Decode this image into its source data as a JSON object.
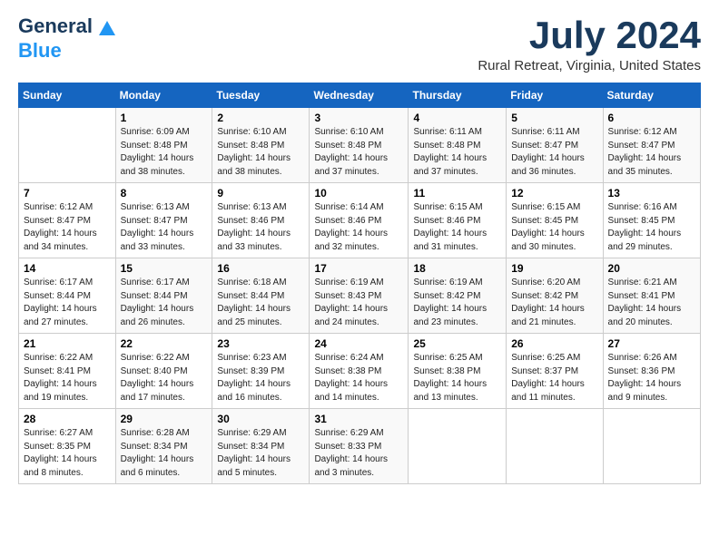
{
  "logo": {
    "general": "General",
    "blue": "Blue"
  },
  "title": "July 2024",
  "location": "Rural Retreat, Virginia, United States",
  "weekdays": [
    "Sunday",
    "Monday",
    "Tuesday",
    "Wednesday",
    "Thursday",
    "Friday",
    "Saturday"
  ],
  "weeks": [
    [
      {
        "day": "",
        "sunrise": "",
        "sunset": "",
        "daylight": ""
      },
      {
        "day": "1",
        "sunrise": "Sunrise: 6:09 AM",
        "sunset": "Sunset: 8:48 PM",
        "daylight": "Daylight: 14 hours and 38 minutes."
      },
      {
        "day": "2",
        "sunrise": "Sunrise: 6:10 AM",
        "sunset": "Sunset: 8:48 PM",
        "daylight": "Daylight: 14 hours and 38 minutes."
      },
      {
        "day": "3",
        "sunrise": "Sunrise: 6:10 AM",
        "sunset": "Sunset: 8:48 PM",
        "daylight": "Daylight: 14 hours and 37 minutes."
      },
      {
        "day": "4",
        "sunrise": "Sunrise: 6:11 AM",
        "sunset": "Sunset: 8:48 PM",
        "daylight": "Daylight: 14 hours and 37 minutes."
      },
      {
        "day": "5",
        "sunrise": "Sunrise: 6:11 AM",
        "sunset": "Sunset: 8:47 PM",
        "daylight": "Daylight: 14 hours and 36 minutes."
      },
      {
        "day": "6",
        "sunrise": "Sunrise: 6:12 AM",
        "sunset": "Sunset: 8:47 PM",
        "daylight": "Daylight: 14 hours and 35 minutes."
      }
    ],
    [
      {
        "day": "7",
        "sunrise": "Sunrise: 6:12 AM",
        "sunset": "Sunset: 8:47 PM",
        "daylight": "Daylight: 14 hours and 34 minutes."
      },
      {
        "day": "8",
        "sunrise": "Sunrise: 6:13 AM",
        "sunset": "Sunset: 8:47 PM",
        "daylight": "Daylight: 14 hours and 33 minutes."
      },
      {
        "day": "9",
        "sunrise": "Sunrise: 6:13 AM",
        "sunset": "Sunset: 8:46 PM",
        "daylight": "Daylight: 14 hours and 33 minutes."
      },
      {
        "day": "10",
        "sunrise": "Sunrise: 6:14 AM",
        "sunset": "Sunset: 8:46 PM",
        "daylight": "Daylight: 14 hours and 32 minutes."
      },
      {
        "day": "11",
        "sunrise": "Sunrise: 6:15 AM",
        "sunset": "Sunset: 8:46 PM",
        "daylight": "Daylight: 14 hours and 31 minutes."
      },
      {
        "day": "12",
        "sunrise": "Sunrise: 6:15 AM",
        "sunset": "Sunset: 8:45 PM",
        "daylight": "Daylight: 14 hours and 30 minutes."
      },
      {
        "day": "13",
        "sunrise": "Sunrise: 6:16 AM",
        "sunset": "Sunset: 8:45 PM",
        "daylight": "Daylight: 14 hours and 29 minutes."
      }
    ],
    [
      {
        "day": "14",
        "sunrise": "Sunrise: 6:17 AM",
        "sunset": "Sunset: 8:44 PM",
        "daylight": "Daylight: 14 hours and 27 minutes."
      },
      {
        "day": "15",
        "sunrise": "Sunrise: 6:17 AM",
        "sunset": "Sunset: 8:44 PM",
        "daylight": "Daylight: 14 hours and 26 minutes."
      },
      {
        "day": "16",
        "sunrise": "Sunrise: 6:18 AM",
        "sunset": "Sunset: 8:44 PM",
        "daylight": "Daylight: 14 hours and 25 minutes."
      },
      {
        "day": "17",
        "sunrise": "Sunrise: 6:19 AM",
        "sunset": "Sunset: 8:43 PM",
        "daylight": "Daylight: 14 hours and 24 minutes."
      },
      {
        "day": "18",
        "sunrise": "Sunrise: 6:19 AM",
        "sunset": "Sunset: 8:42 PM",
        "daylight": "Daylight: 14 hours and 23 minutes."
      },
      {
        "day": "19",
        "sunrise": "Sunrise: 6:20 AM",
        "sunset": "Sunset: 8:42 PM",
        "daylight": "Daylight: 14 hours and 21 minutes."
      },
      {
        "day": "20",
        "sunrise": "Sunrise: 6:21 AM",
        "sunset": "Sunset: 8:41 PM",
        "daylight": "Daylight: 14 hours and 20 minutes."
      }
    ],
    [
      {
        "day": "21",
        "sunrise": "Sunrise: 6:22 AM",
        "sunset": "Sunset: 8:41 PM",
        "daylight": "Daylight: 14 hours and 19 minutes."
      },
      {
        "day": "22",
        "sunrise": "Sunrise: 6:22 AM",
        "sunset": "Sunset: 8:40 PM",
        "daylight": "Daylight: 14 hours and 17 minutes."
      },
      {
        "day": "23",
        "sunrise": "Sunrise: 6:23 AM",
        "sunset": "Sunset: 8:39 PM",
        "daylight": "Daylight: 14 hours and 16 minutes."
      },
      {
        "day": "24",
        "sunrise": "Sunrise: 6:24 AM",
        "sunset": "Sunset: 8:38 PM",
        "daylight": "Daylight: 14 hours and 14 minutes."
      },
      {
        "day": "25",
        "sunrise": "Sunrise: 6:25 AM",
        "sunset": "Sunset: 8:38 PM",
        "daylight": "Daylight: 14 hours and 13 minutes."
      },
      {
        "day": "26",
        "sunrise": "Sunrise: 6:25 AM",
        "sunset": "Sunset: 8:37 PM",
        "daylight": "Daylight: 14 hours and 11 minutes."
      },
      {
        "day": "27",
        "sunrise": "Sunrise: 6:26 AM",
        "sunset": "Sunset: 8:36 PM",
        "daylight": "Daylight: 14 hours and 9 minutes."
      }
    ],
    [
      {
        "day": "28",
        "sunrise": "Sunrise: 6:27 AM",
        "sunset": "Sunset: 8:35 PM",
        "daylight": "Daylight: 14 hours and 8 minutes."
      },
      {
        "day": "29",
        "sunrise": "Sunrise: 6:28 AM",
        "sunset": "Sunset: 8:34 PM",
        "daylight": "Daylight: 14 hours and 6 minutes."
      },
      {
        "day": "30",
        "sunrise": "Sunrise: 6:29 AM",
        "sunset": "Sunset: 8:34 PM",
        "daylight": "Daylight: 14 hours and 5 minutes."
      },
      {
        "day": "31",
        "sunrise": "Sunrise: 6:29 AM",
        "sunset": "Sunset: 8:33 PM",
        "daylight": "Daylight: 14 hours and 3 minutes."
      },
      {
        "day": "",
        "sunrise": "",
        "sunset": "",
        "daylight": ""
      },
      {
        "day": "",
        "sunrise": "",
        "sunset": "",
        "daylight": ""
      },
      {
        "day": "",
        "sunrise": "",
        "sunset": "",
        "daylight": ""
      }
    ]
  ]
}
